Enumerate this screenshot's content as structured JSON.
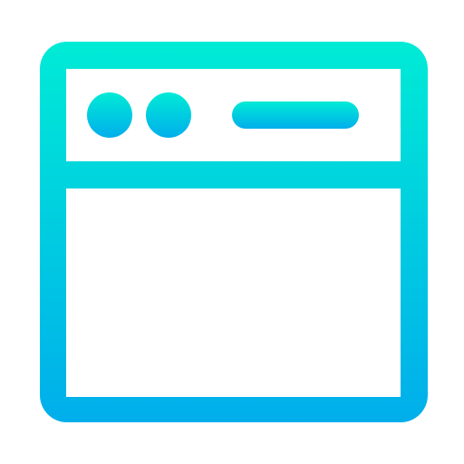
{
  "icon": {
    "name": "browser-window-icon",
    "colors": {
      "gradient_top": "#00EBD6",
      "gradient_bottom": "#00AEEB",
      "background": "#FFFFFF"
    },
    "parts": {
      "window_frame": "window-frame",
      "title_bar": "title-bar",
      "control_dots": [
        "control-dot",
        "control-dot"
      ],
      "address_bar": "address-bar-pill",
      "content_area": "content-area"
    }
  }
}
